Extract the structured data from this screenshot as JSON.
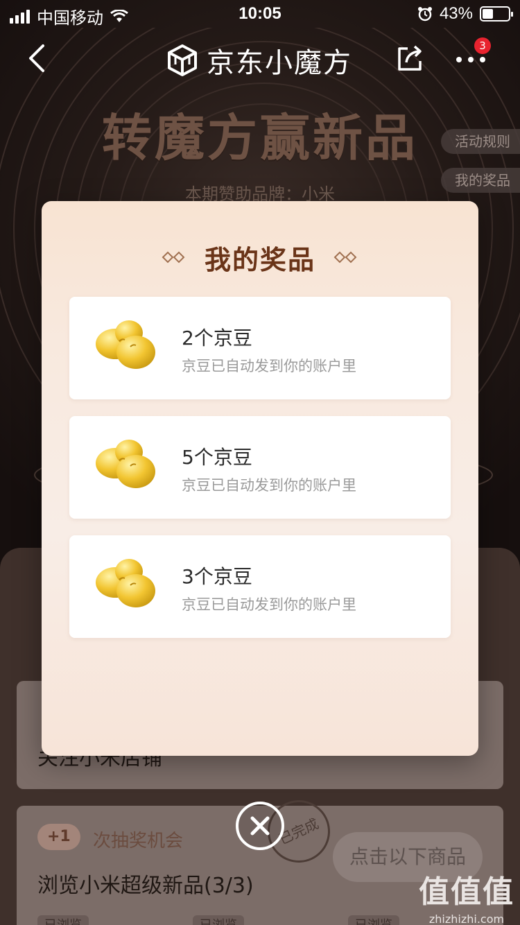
{
  "status_bar": {
    "carrier": "中国移动",
    "time": "10:05",
    "battery_percent": "43%"
  },
  "nav": {
    "title": "京东小魔方",
    "badge_count": "3"
  },
  "background": {
    "hero_title": "转魔方赢新品",
    "sponsor": "本期赞助品牌：小米",
    "side_tabs": [
      "活动规则",
      "我的奖品"
    ],
    "task2": {
      "plus": "+1",
      "reward_text": "次抽奖机会",
      "title": "浏览小米超级新品(3/3)",
      "button": "点击以下商品",
      "stamp": "已完成",
      "viewed_label": "已浏览"
    },
    "task1_title_partial": "关注小米店铺"
  },
  "modal": {
    "title": "我的奖品",
    "prizes": [
      {
        "name": "2个京豆",
        "desc": "京豆已自动发到你的账户里",
        "icon": "jd-bean-icon"
      },
      {
        "name": "5个京豆",
        "desc": "京豆已自动发到你的账户里",
        "icon": "jd-bean-icon"
      },
      {
        "name": "3个京豆",
        "desc": "京豆已自动发到你的账户里",
        "icon": "jd-bean-icon"
      }
    ]
  },
  "watermark": {
    "big": "值值值",
    "small": "zhizhizhi.com"
  }
}
